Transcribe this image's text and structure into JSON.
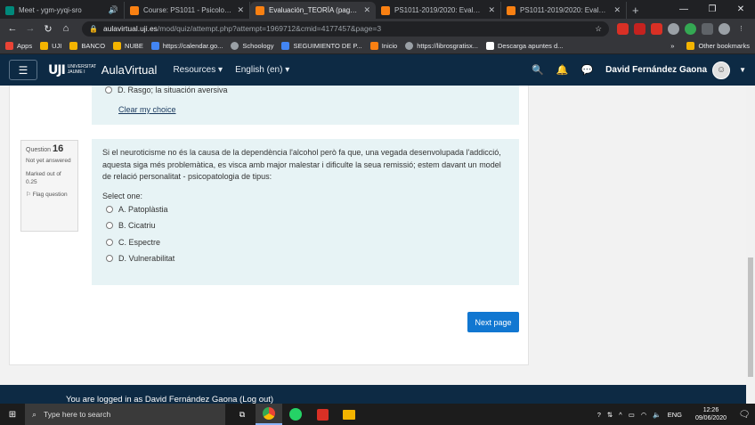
{
  "browser": {
    "tabs": [
      {
        "title": "Meet - ygm-yyqi-sro",
        "icon": "meet-icon",
        "color": "#00897b",
        "active": false
      },
      {
        "title": "Course: PS1011 - Psicologia de",
        "icon": "moodle-icon",
        "color": "#f98012",
        "active": false
      },
      {
        "title": "Evaluación_TEORÍA (page 4 of",
        "icon": "moodle-icon",
        "color": "#f98012",
        "active": true
      },
      {
        "title": "PS1011-2019/2020: Evaluación",
        "icon": "moodle-icon",
        "color": "#f98012",
        "active": false
      },
      {
        "title": "PS1011-2019/2020: Evaluación",
        "icon": "moodle-icon",
        "color": "#f98012",
        "active": false
      }
    ],
    "url_host": "aulavirtual.uji.es",
    "url_path": "/mod/quiz/attempt.php?attempt=1969712&cmid=4177457&page=3",
    "bookmarks": [
      {
        "label": "Apps",
        "color": "#ea4335"
      },
      {
        "label": "UJI",
        "color": "#f4b400"
      },
      {
        "label": "BANCO",
        "color": "#f4b400"
      },
      {
        "label": "NUBE",
        "color": "#f4b400"
      },
      {
        "label": "https://calendar.go...",
        "color": "#4285f4"
      },
      {
        "label": "Schoology",
        "color": "#9aa0a6"
      },
      {
        "label": "SEGUIMIENTO DE P...",
        "color": "#4285f4"
      },
      {
        "label": "Inicio",
        "color": "#f98012"
      },
      {
        "label": "https://librosgratisx...",
        "color": "#9aa0a6"
      },
      {
        "label": "Descarga apuntes d...",
        "color": "#ffffff"
      }
    ],
    "other_bookmarks": "Other bookmarks"
  },
  "header": {
    "university": "UNIVERSITAT JAUME I",
    "logo_mark": "UJI",
    "brand": "AulaVirtual",
    "menu": [
      "Resources",
      "English (en)"
    ],
    "user": "David Fernández Gaona"
  },
  "prev_question": {
    "option": "D. Rasgo; la situación aversiva",
    "clear": "Clear my choice"
  },
  "question": {
    "label": "Question",
    "number": "16",
    "status": "Not yet answered",
    "marked": "Marked out of 0.25",
    "flag": "Flag question",
    "text": "Si el neuroticisme no és la causa de la dependència l'alcohol però fa que, una vegada desenvolupada l'addicció, aquesta siga més problemàtica, es visca amb major malestar i dificulte la seua remissió; estem davant un model de relació personalitat - psicopatologia de tipus:",
    "select_one": "Select one:",
    "options": [
      "A. Patoplàstia",
      "B. Cicatriu",
      "C. Espectre",
      "D. Vulnerabilitat"
    ]
  },
  "next_button": "Next page",
  "footer_text": "You are logged in as David Fernández Gaona (Log out)",
  "taskbar": {
    "search_placeholder": "Type here to search",
    "lang": "ENG",
    "time": "12:26",
    "date": "09/06/2020"
  }
}
